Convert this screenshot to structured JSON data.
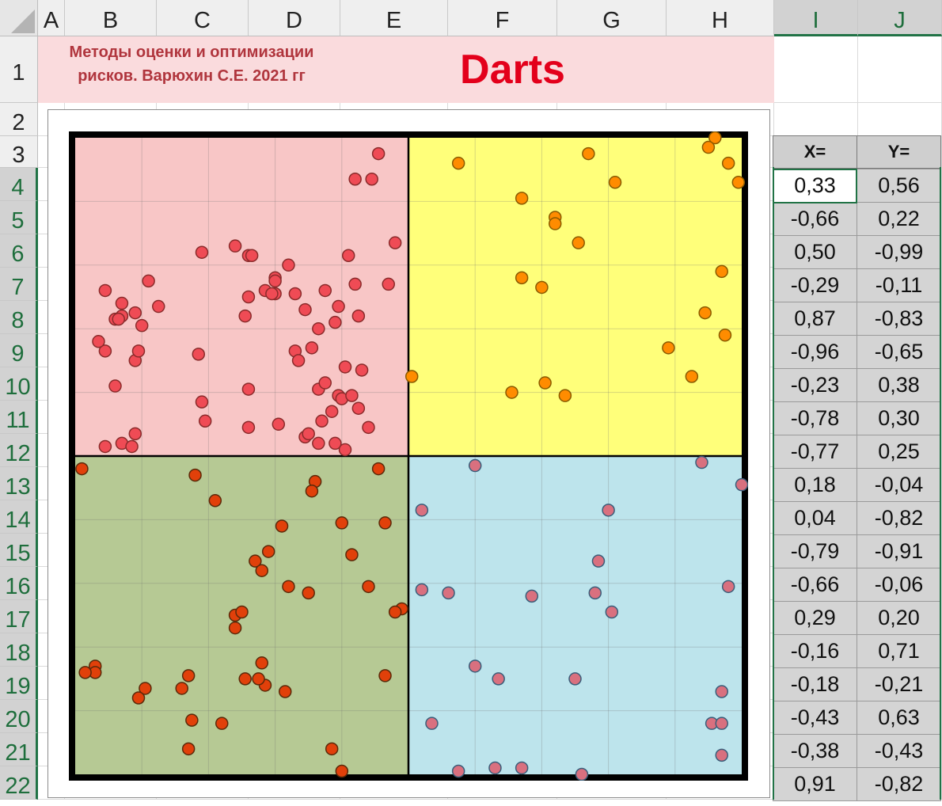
{
  "columns": [
    {
      "label": "A",
      "w": 34
    },
    {
      "label": "B",
      "w": 116
    },
    {
      "label": "C",
      "w": 116
    },
    {
      "label": "D",
      "w": 116
    },
    {
      "label": "E",
      "w": 136
    },
    {
      "label": "F",
      "w": 138
    },
    {
      "label": "G",
      "w": 138
    },
    {
      "label": "H",
      "w": 136
    },
    {
      "label": "I",
      "w": 106,
      "sel": true
    },
    {
      "label": "J",
      "w": 106,
      "sel": true
    }
  ],
  "rows": [
    {
      "label": "1",
      "h": 84
    },
    {
      "label": "2",
      "h": 42
    },
    {
      "label": "3",
      "h": 40
    },
    {
      "label": "4",
      "h": 42,
      "sel": true
    },
    {
      "label": "5",
      "h": 42,
      "sel": true
    },
    {
      "label": "6",
      "h": 42,
      "sel": true
    },
    {
      "label": "7",
      "h": 42,
      "sel": true
    },
    {
      "label": "8",
      "h": 42,
      "sel": true
    },
    {
      "label": "9",
      "h": 42,
      "sel": true
    },
    {
      "label": "10",
      "h": 42,
      "sel": true
    },
    {
      "label": "11",
      "h": 42,
      "sel": true
    },
    {
      "label": "12",
      "h": 42,
      "sel": true
    },
    {
      "label": "13",
      "h": 42,
      "sel": true
    },
    {
      "label": "14",
      "h": 42,
      "sel": true
    },
    {
      "label": "15",
      "h": 42,
      "sel": true
    },
    {
      "label": "16",
      "h": 42,
      "sel": true
    },
    {
      "label": "17",
      "h": 42,
      "sel": true
    },
    {
      "label": "18",
      "h": 42,
      "sel": true
    },
    {
      "label": "19",
      "h": 42,
      "sel": true
    },
    {
      "label": "20",
      "h": 42,
      "sel": true
    },
    {
      "label": "21",
      "h": 42,
      "sel": true
    },
    {
      "label": "22",
      "h": 42,
      "sel": true
    }
  ],
  "header": {
    "subtitle_line1": "Методы оценки и оптимизации",
    "subtitle_line2": "рисков.   Варюхин С.Е.     2021 гг",
    "title": "Darts"
  },
  "table": {
    "x_header": "X=",
    "y_header": "Y=",
    "rows": [
      [
        "0,33",
        "0,56"
      ],
      [
        "-0,66",
        "0,22"
      ],
      [
        "0,50",
        "-0,99"
      ],
      [
        "-0,29",
        "-0,11"
      ],
      [
        "0,87",
        "-0,83"
      ],
      [
        "-0,96",
        "-0,65"
      ],
      [
        "-0,23",
        "0,38"
      ],
      [
        "-0,78",
        "0,30"
      ],
      [
        "-0,77",
        "0,25"
      ],
      [
        "0,18",
        "-0,04"
      ],
      [
        "0,04",
        "-0,82"
      ],
      [
        "-0,79",
        "-0,91"
      ],
      [
        "-0,66",
        "-0,06"
      ],
      [
        "0,29",
        "0,20"
      ],
      [
        "-0,16",
        "0,71"
      ],
      [
        "-0,18",
        "-0,21"
      ],
      [
        "-0,43",
        "0,63"
      ],
      [
        "-0,38",
        "-0,43"
      ],
      [
        "0,91",
        "-0,82"
      ]
    ]
  },
  "chart_data": {
    "type": "scatter",
    "xlim": [
      -1,
      1
    ],
    "ylim": [
      -1,
      1
    ],
    "grid": true,
    "quadrant_colors": {
      "top_left": "#f8c6c6",
      "top_right": "#ffff7a",
      "bottom_left": "#b6c994",
      "bottom_right": "#bde4ec"
    },
    "series": [
      {
        "quadrant": "top_left",
        "fill": "#ef4b55",
        "stroke": "#8a2b2b",
        "points": [
          [
            -0.09,
            0.95
          ],
          [
            -0.62,
            0.64
          ],
          [
            -0.48,
            0.63
          ],
          [
            -0.91,
            0.52
          ],
          [
            -0.86,
            0.48
          ],
          [
            -0.48,
            0.5
          ],
          [
            -0.43,
            0.52
          ],
          [
            -0.11,
            0.87
          ],
          [
            -0.82,
            0.3
          ],
          [
            -0.88,
            0.22
          ],
          [
            -0.62,
            0.17
          ],
          [
            -0.61,
            0.11
          ],
          [
            -0.48,
            0.09
          ],
          [
            -0.39,
            0.1
          ],
          [
            -0.4,
            0.51
          ],
          [
            -0.25,
            0.52
          ],
          [
            -0.06,
            0.54
          ],
          [
            -0.15,
            0.44
          ],
          [
            -0.19,
            0.28
          ],
          [
            -0.22,
            0.42
          ],
          [
            -0.23,
            0.14
          ],
          [
            -0.27,
            0.21
          ],
          [
            -0.21,
            0.19
          ],
          [
            -0.29,
            0.34
          ],
          [
            -0.36,
            0.6
          ],
          [
            -0.41,
            0.51
          ],
          [
            -0.31,
            0.06
          ],
          [
            -0.86,
            0.04
          ],
          [
            -0.27,
            0.04
          ],
          [
            -0.14,
            0.27
          ],
          [
            -0.2,
            0.18
          ],
          [
            -0.78,
            0.55
          ],
          [
            -0.82,
            0.07
          ],
          [
            -0.83,
            0.03
          ],
          [
            -0.91,
            0.33
          ],
          [
            -0.18,
            0.63
          ],
          [
            -0.27,
            0.4
          ],
          [
            -0.17,
            0.19
          ],
          [
            -0.34,
            0.33
          ],
          [
            -0.4,
            0.56
          ],
          [
            -0.88,
            0.43
          ],
          [
            -0.48,
            0.21
          ],
          [
            -0.3,
            0.07
          ],
          [
            -0.25,
            0.23
          ],
          [
            -0.15,
            0.15
          ],
          [
            -0.19,
            0.02
          ],
          [
            -0.86,
            0.44
          ],
          [
            -0.87,
            0.43
          ],
          [
            -0.33,
            0.3
          ],
          [
            -0.31,
            0.46
          ],
          [
            -0.4,
            0.55
          ],
          [
            -0.21,
            0.47
          ],
          [
            -0.47,
            0.63
          ],
          [
            -0.34,
            0.51
          ],
          [
            -0.26,
            0.11
          ],
          [
            -0.16,
            0.87
          ],
          [
            -0.04,
            0.67
          ],
          [
            -0.91,
            0.03
          ],
          [
            -0.81,
            0.33
          ],
          [
            -0.75,
            0.47
          ],
          [
            -0.82,
            0.45
          ],
          [
            -0.93,
            0.36
          ],
          [
            -0.8,
            0.41
          ],
          [
            -0.63,
            0.32
          ],
          [
            -0.52,
            0.66
          ],
          [
            -0.16,
            0.54
          ],
          [
            -0.12,
            0.09
          ],
          [
            -0.22,
            0.04
          ],
          [
            -0.49,
            0.44
          ]
        ]
      },
      {
        "quadrant": "top_right",
        "fill": "#ff8c00",
        "stroke": "#8a5a00",
        "points": [
          [
            0.15,
            0.92
          ],
          [
            0.54,
            0.95
          ],
          [
            0.92,
            1.0
          ],
          [
            0.9,
            0.97
          ],
          [
            0.96,
            0.92
          ],
          [
            0.99,
            0.86
          ],
          [
            0.62,
            0.86
          ],
          [
            0.34,
            0.81
          ],
          [
            0.44,
            0.75
          ],
          [
            0.44,
            0.73
          ],
          [
            0.51,
            0.67
          ],
          [
            0.94,
            0.58
          ],
          [
            0.34,
            0.56
          ],
          [
            0.4,
            0.53
          ],
          [
            0.89,
            0.45
          ],
          [
            0.95,
            0.38
          ],
          [
            0.78,
            0.34
          ],
          [
            0.85,
            0.25
          ],
          [
            0.01,
            0.25
          ],
          [
            0.31,
            0.2
          ],
          [
            0.41,
            0.23
          ],
          [
            0.47,
            0.19
          ]
        ]
      },
      {
        "quadrant": "bottom_left",
        "fill": "#e1400a",
        "stroke": "#5a2a0a",
        "points": [
          [
            -0.98,
            -0.04
          ],
          [
            -0.64,
            -0.06
          ],
          [
            -0.28,
            -0.08
          ],
          [
            -0.29,
            -0.11
          ],
          [
            -0.58,
            -0.14
          ],
          [
            -0.07,
            -0.21
          ],
          [
            -0.46,
            -0.33
          ],
          [
            -0.36,
            -0.41
          ],
          [
            -0.3,
            -0.43
          ],
          [
            -0.12,
            -0.41
          ],
          [
            -0.52,
            -0.5
          ],
          [
            -0.5,
            -0.49
          ],
          [
            -0.94,
            -0.66
          ],
          [
            -0.79,
            -0.73
          ],
          [
            -0.49,
            -0.7
          ],
          [
            -0.94,
            -0.68
          ],
          [
            -0.43,
            -0.72
          ],
          [
            -0.02,
            -0.48
          ],
          [
            -0.04,
            -0.49
          ],
          [
            -0.66,
            -0.69
          ],
          [
            -0.65,
            -0.83
          ],
          [
            -0.68,
            -0.73
          ],
          [
            -0.44,
            -0.65
          ],
          [
            -0.37,
            -0.74
          ],
          [
            -0.66,
            -0.92
          ],
          [
            -0.2,
            -0.99
          ],
          [
            -0.23,
            -0.92
          ],
          [
            -0.81,
            -0.76
          ],
          [
            -0.45,
            -0.7
          ],
          [
            -0.56,
            -0.84
          ],
          [
            -0.07,
            -0.69
          ],
          [
            -0.17,
            -0.31
          ],
          [
            -0.09,
            -0.04
          ],
          [
            -0.44,
            -0.36
          ],
          [
            -0.52,
            -0.54
          ],
          [
            -0.42,
            -0.3
          ],
          [
            -0.38,
            -0.22
          ],
          [
            -0.2,
            -0.21
          ],
          [
            -0.97,
            -0.68
          ]
        ]
      },
      {
        "quadrant": "bottom_right",
        "fill": "#d9707f",
        "stroke": "#3a5e7a",
        "points": [
          [
            0.2,
            -0.03
          ],
          [
            0.88,
            -0.02
          ],
          [
            1.0,
            -0.09
          ],
          [
            0.04,
            -0.17
          ],
          [
            0.6,
            -0.17
          ],
          [
            0.57,
            -0.33
          ],
          [
            0.04,
            -0.42
          ],
          [
            0.12,
            -0.43
          ],
          [
            0.37,
            -0.44
          ],
          [
            0.56,
            -0.43
          ],
          [
            0.61,
            -0.49
          ],
          [
            0.96,
            -0.41
          ],
          [
            0.2,
            -0.66
          ],
          [
            0.27,
            -0.7
          ],
          [
            0.5,
            -0.7
          ],
          [
            0.94,
            -0.74
          ],
          [
            0.07,
            -0.84
          ],
          [
            0.91,
            -0.84
          ],
          [
            0.94,
            -0.84
          ],
          [
            0.94,
            -0.94
          ],
          [
            0.26,
            -0.98
          ],
          [
            0.34,
            -0.98
          ],
          [
            0.15,
            -0.99
          ],
          [
            0.52,
            -1.0
          ]
        ]
      }
    ]
  }
}
